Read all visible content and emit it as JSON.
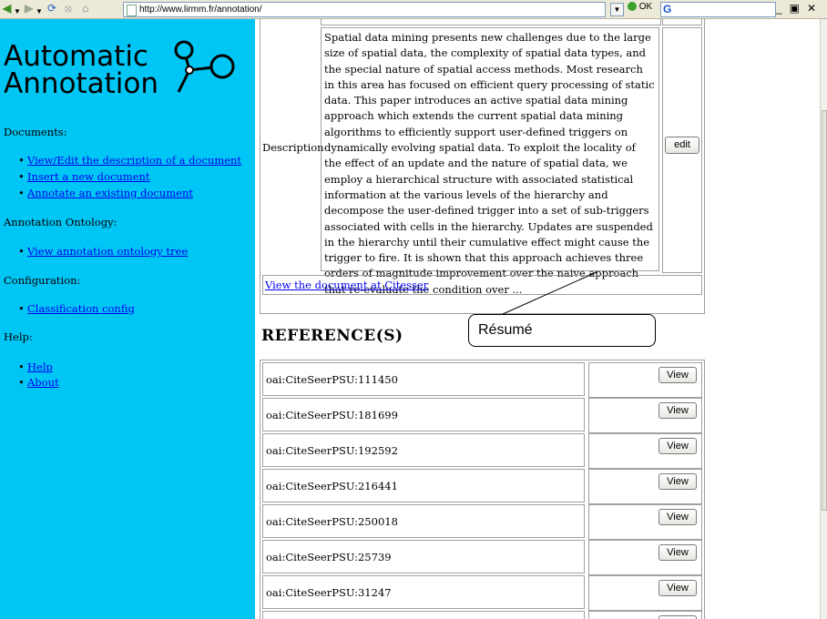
{
  "browser": {
    "url": "http://www.lirmm.fr/annotation/",
    "go_label": "OK",
    "search_logo": "G"
  },
  "sidebar": {
    "logo_line1": "Automatic",
    "logo_line2": "Annotation",
    "sections": [
      {
        "title": "Documents:",
        "items": [
          "View/Edit the description of a document",
          "Insert a new document",
          "Annotate an existing document"
        ]
      },
      {
        "title": "Annotation Ontology:",
        "items": [
          "View annotation ontology tree"
        ]
      },
      {
        "title": "Configuration:",
        "items": [
          "Classification config"
        ]
      },
      {
        "title": "Help:",
        "items": [
          "Help",
          "About"
        ]
      }
    ],
    "background": "#00c6f5"
  },
  "description": {
    "label": "Description",
    "text": "Spatial data mining presents new challenges due to the large size of spatial data, the complexity of spatial data types, and the special nature of spatial access methods. Most research in this area has focused on efficient query processing of static data. This paper introduces an active spatial data mining approach which extends the current spatial data mining algorithms to efficiently support user-defined triggers on dynamically evolving spatial data. To exploit the locality of the effect of an update and the nature of spatial data, we employ a hierarchical structure with associated statistical information at the various levels of the hierarchy and decompose the user-defined trigger into a set of sub-triggers associated with cells in the hierarchy. Updates are suspended in the hierarchy until their cumulative effect might cause the trigger to fire. It is shown that this approach achieves three orders of magnitude improvement over the naive approach that re-evaluate the condition over ...",
    "edit_label": "edit",
    "view_link": "View the document at Citesser"
  },
  "annotation_callout": "Résumé",
  "references": {
    "title": "REFERENCE(S)",
    "view_label": "View",
    "rows": [
      "oai:CiteSeerPSU:111450",
      "oai:CiteSeerPSU:181699",
      "oai:CiteSeerPSU:192592",
      "oai:CiteSeerPSU:216441",
      "oai:CiteSeerPSU:250018",
      "oai:CiteSeerPSU:25739",
      "oai:CiteSeerPSU:31247",
      ""
    ]
  }
}
